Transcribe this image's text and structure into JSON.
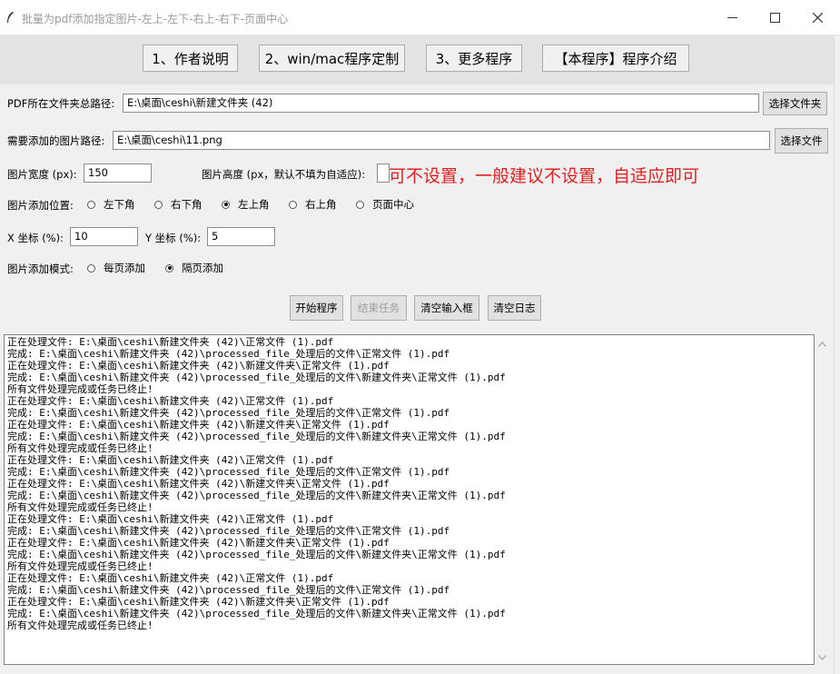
{
  "window": {
    "title": "批量为pdf添加指定图片-左上-左下-右上-右下-页面中心",
    "controls": [
      "minimize-icon",
      "maximize-icon",
      "close-icon"
    ]
  },
  "topbar": {
    "buttons": [
      "1、作者说明",
      "2、win/mac程序定制",
      "3、更多程序",
      "【本程序】程序介绍"
    ]
  },
  "form": {
    "pdf_path_label": "PDF所在文件夹总路径:",
    "pdf_path_value": "E:\\桌面\\ceshi\\新建文件夹 (42)",
    "pdf_path_button": "选择文件夹",
    "image_path_label": "需要添加的图片路径:",
    "image_path_value": "E:\\桌面\\ceshi\\11.png",
    "image_path_button": "选择文件",
    "width_label": "图片宽度 (px):",
    "width_value": "150",
    "height_label": "图片高度 (px，默认不填为自适应):",
    "height_value": "",
    "height_hint": "可不设置，一般建议不设置，自适应即可",
    "position_label": "图片添加位置:",
    "position_options": [
      "左下角",
      "右下角",
      "左上角",
      "右上角",
      "页面中心"
    ],
    "position_selected": "左上角",
    "x_label": "X 坐标 (%):",
    "x_value": "10",
    "y_label": "Y 坐标 (%):",
    "y_value": "5",
    "mode_label": "图片添加模式:",
    "mode_options": [
      "每页添加",
      "隔页添加"
    ],
    "mode_selected": "隔页添加"
  },
  "actions": {
    "start": "开始程序",
    "stop": "结束任务",
    "clear_inputs": "清空输入框",
    "clear_log": "清空日志"
  },
  "log": {
    "lines": [
      "正在处理文件: E:\\桌面\\ceshi\\新建文件夹 (42)\\正常文件 (1).pdf",
      "完成: E:\\桌面\\ceshi\\新建文件夹 (42)\\processed_file_处理后的文件\\正常文件 (1).pdf",
      "正在处理文件: E:\\桌面\\ceshi\\新建文件夹 (42)\\新建文件夹\\正常文件 (1).pdf",
      "完成: E:\\桌面\\ceshi\\新建文件夹 (42)\\processed_file_处理后的文件\\新建文件夹\\正常文件 (1).pdf",
      "所有文件处理完成或任务已终止!",
      "正在处理文件: E:\\桌面\\ceshi\\新建文件夹 (42)\\正常文件 (1).pdf",
      "完成: E:\\桌面\\ceshi\\新建文件夹 (42)\\processed_file_处理后的文件\\正常文件 (1).pdf",
      "正在处理文件: E:\\桌面\\ceshi\\新建文件夹 (42)\\新建文件夹\\正常文件 (1).pdf",
      "完成: E:\\桌面\\ceshi\\新建文件夹 (42)\\processed_file_处理后的文件\\新建文件夹\\正常文件 (1).pdf",
      "所有文件处理完成或任务已终止!",
      "正在处理文件: E:\\桌面\\ceshi\\新建文件夹 (42)\\正常文件 (1).pdf",
      "完成: E:\\桌面\\ceshi\\新建文件夹 (42)\\processed_file_处理后的文件\\正常文件 (1).pdf",
      "正在处理文件: E:\\桌面\\ceshi\\新建文件夹 (42)\\新建文件夹\\正常文件 (1).pdf",
      "完成: E:\\桌面\\ceshi\\新建文件夹 (42)\\processed_file_处理后的文件\\新建文件夹\\正常文件 (1).pdf",
      "所有文件处理完成或任务已终止!",
      "正在处理文件: E:\\桌面\\ceshi\\新建文件夹 (42)\\正常文件 (1).pdf",
      "完成: E:\\桌面\\ceshi\\新建文件夹 (42)\\processed_file_处理后的文件\\正常文件 (1).pdf",
      "正在处理文件: E:\\桌面\\ceshi\\新建文件夹 (42)\\新建文件夹\\正常文件 (1).pdf",
      "完成: E:\\桌面\\ceshi\\新建文件夹 (42)\\processed_file_处理后的文件\\新建文件夹\\正常文件 (1).pdf",
      "所有文件处理完成或任务已终止!",
      "正在处理文件: E:\\桌面\\ceshi\\新建文件夹 (42)\\正常文件 (1).pdf",
      "完成: E:\\桌面\\ceshi\\新建文件夹 (42)\\processed_file_处理后的文件\\正常文件 (1).pdf",
      "正在处理文件: E:\\桌面\\ceshi\\新建文件夹 (42)\\新建文件夹\\正常文件 (1).pdf",
      "完成: E:\\桌面\\ceshi\\新建文件夹 (42)\\processed_file_处理后的文件\\新建文件夹\\正常文件 (1).pdf",
      "所有文件处理完成或任务已终止!"
    ]
  },
  "colors": {
    "hint": "#e02020",
    "topbar_bg": "#e3e3e3",
    "window_bg": "#f0f0f0"
  }
}
